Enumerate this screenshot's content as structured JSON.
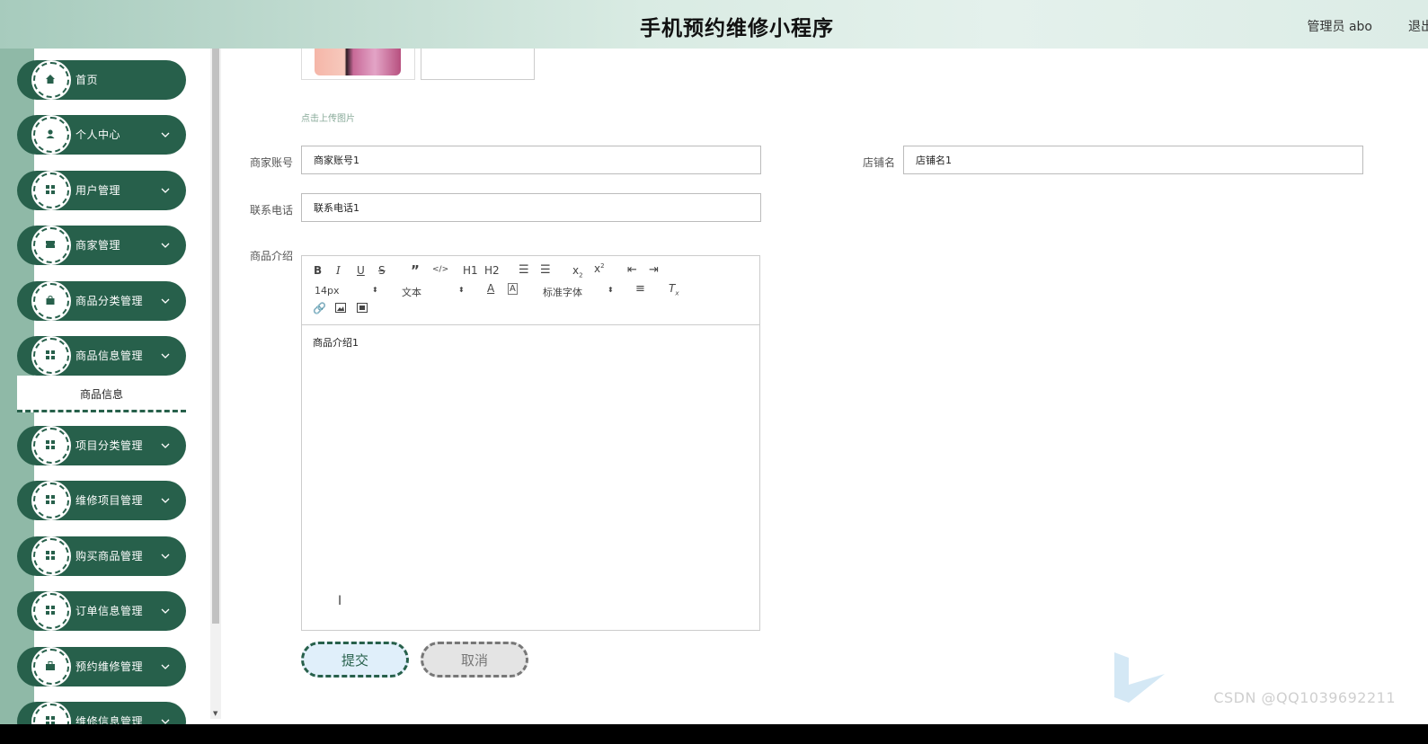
{
  "header": {
    "title": "手机预约维修小程序",
    "user": "管理员 abo",
    "logout": "退出"
  },
  "sidebar": {
    "items": [
      {
        "label": "首页",
        "icon": "home-icon"
      },
      {
        "label": "个人中心",
        "icon": "user-icon"
      },
      {
        "label": "用户管理",
        "icon": "grid-icon"
      },
      {
        "label": "商家管理",
        "icon": "ticket-icon"
      },
      {
        "label": "商品分类管理",
        "icon": "bag-icon"
      },
      {
        "label": "商品信息管理",
        "icon": "grid-icon"
      },
      {
        "label": "项目分类管理",
        "icon": "grid-icon"
      },
      {
        "label": "维修项目管理",
        "icon": "grid-icon"
      },
      {
        "label": "购买商品管理",
        "icon": "grid-icon"
      },
      {
        "label": "订单信息管理",
        "icon": "grid-icon"
      },
      {
        "label": "预约维修管理",
        "icon": "briefcase-icon"
      },
      {
        "label": "维修信息管理",
        "icon": "grid-icon"
      }
    ],
    "submenu_label": "商品信息"
  },
  "form": {
    "upload_hint": "点击上传图片",
    "account_label": "商家账号",
    "account_value": "商家账号1",
    "shop_label": "店铺名",
    "shop_value": "店铺名1",
    "phone_label": "联系电话",
    "phone_value": "联系电话1",
    "intro_label": "商品介绍",
    "intro_value": "商品介绍1",
    "submit_label": "提交",
    "cancel_label": "取消"
  },
  "editor_toolbar": {
    "size": "14px",
    "header": "文本",
    "font": "标准字体",
    "h1": "H1",
    "h2": "H2"
  },
  "watermark": "CSDN @QQ1039692211",
  "colors": {
    "primary": "#27604b",
    "header_gradient_start": "#a7cbbd",
    "submit_bg": "#e0effa"
  }
}
